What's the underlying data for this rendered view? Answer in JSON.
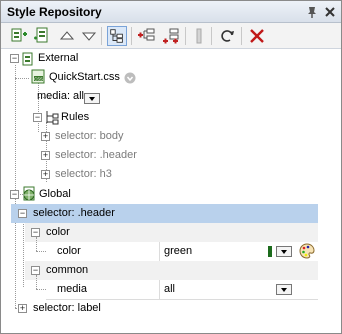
{
  "window": {
    "title": "Style Repository"
  },
  "icons": {
    "pin": "pin-icon",
    "close": "close-icon",
    "toolbar": [
      "add-stylesheet-icon",
      "add-global-icon",
      "move-up-icon",
      "move-down-icon",
      "toggle-view-icon",
      "add-selector-icon",
      "add-selector-after-icon",
      "disabled-icon",
      "reload-icon",
      "delete-icon"
    ]
  },
  "tree": {
    "external_label": "External",
    "stylesheet_name": "QuickStart.css",
    "media_label": "media:",
    "media_value": "all",
    "rules_label": "Rules",
    "rules": [
      "selector: body",
      "selector: .header",
      "selector: h3"
    ],
    "global_label": "Global",
    "selected_selector": "selector: .header",
    "color_group": "color",
    "color_prop": "color",
    "color_value": "green",
    "common_group": "common",
    "media_prop": "media",
    "media_prop_value": "all",
    "label_selector": "selector: label"
  },
  "colors": {
    "swatch": "#1c6b1c",
    "selection": "#b9d1ec"
  }
}
